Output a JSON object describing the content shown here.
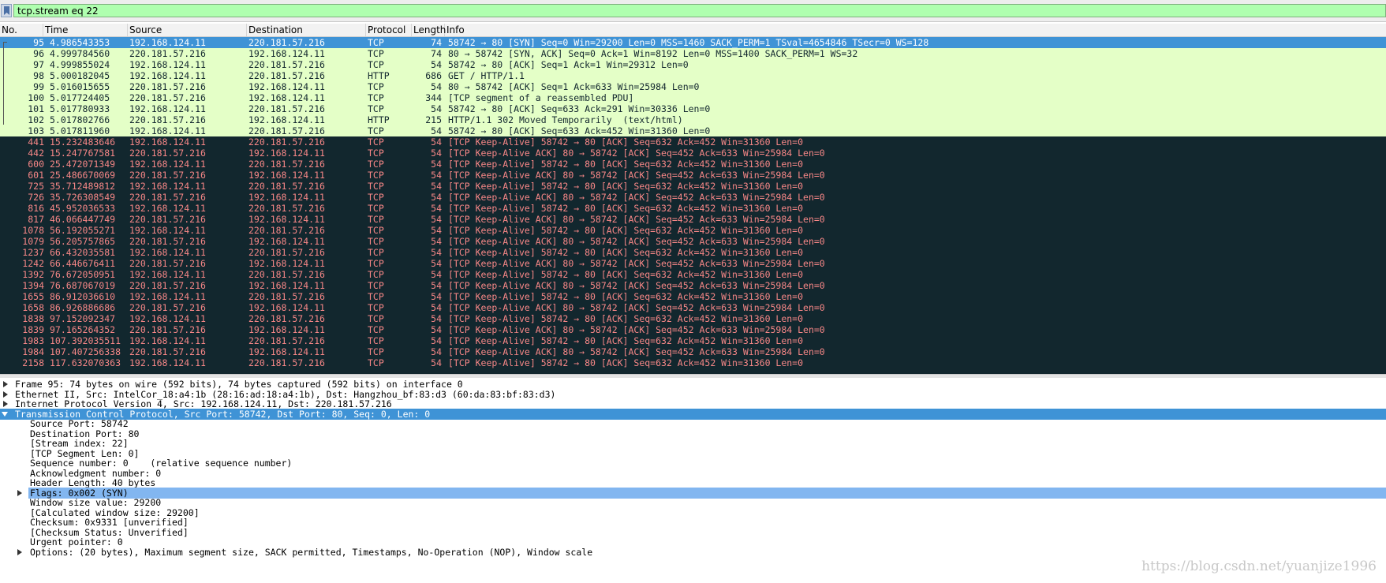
{
  "filter": {
    "value": "tcp.stream eq 22"
  },
  "columns": [
    "No.",
    "Time",
    "Source",
    "Destination",
    "Protocol",
    "Length",
    "Info"
  ],
  "packets": [
    {
      "no": "95",
      "time": "4.986543353",
      "src": "192.168.124.11",
      "dst": "220.181.57.216",
      "proto": "TCP",
      "len": "74",
      "info": "58742 → 80 [SYN] Seq=0 Win=29200 Len=0 MSS=1460 SACK_PERM=1 TSval=4654846 TSecr=0 WS=128",
      "style": "selected"
    },
    {
      "no": "96",
      "time": "4.999784560",
      "src": "220.181.57.216",
      "dst": "192.168.124.11",
      "proto": "TCP",
      "len": "74",
      "info": "80 → 58742 [SYN, ACK] Seq=0 Ack=1 Win=8192 Len=0 MSS=1400 SACK_PERM=1 WS=32",
      "style": "green"
    },
    {
      "no": "97",
      "time": "4.999855024",
      "src": "192.168.124.11",
      "dst": "220.181.57.216",
      "proto": "TCP",
      "len": "54",
      "info": "58742 → 80 [ACK] Seq=1 Ack=1 Win=29312 Len=0",
      "style": "green"
    },
    {
      "no": "98",
      "time": "5.000182045",
      "src": "192.168.124.11",
      "dst": "220.181.57.216",
      "proto": "HTTP",
      "len": "686",
      "info": "GET / HTTP/1.1",
      "style": "green"
    },
    {
      "no": "99",
      "time": "5.016015655",
      "src": "220.181.57.216",
      "dst": "192.168.124.11",
      "proto": "TCP",
      "len": "54",
      "info": "80 → 58742 [ACK] Seq=1 Ack=633 Win=25984 Len=0",
      "style": "green"
    },
    {
      "no": "100",
      "time": "5.017724405",
      "src": "220.181.57.216",
      "dst": "192.168.124.11",
      "proto": "TCP",
      "len": "344",
      "info": "[TCP segment of a reassembled PDU]",
      "style": "green"
    },
    {
      "no": "101",
      "time": "5.017780933",
      "src": "192.168.124.11",
      "dst": "220.181.57.216",
      "proto": "TCP",
      "len": "54",
      "info": "58742 → 80 [ACK] Seq=633 Ack=291 Win=30336 Len=0",
      "style": "green"
    },
    {
      "no": "102",
      "time": "5.017802766",
      "src": "220.181.57.216",
      "dst": "192.168.124.11",
      "proto": "HTTP",
      "len": "215",
      "info": "HTTP/1.1 302 Moved Temporarily  (text/html)",
      "style": "green"
    },
    {
      "no": "103",
      "time": "5.017811960",
      "src": "192.168.124.11",
      "dst": "220.181.57.216",
      "proto": "TCP",
      "len": "54",
      "info": "58742 → 80 [ACK] Seq=633 Ack=452 Win=31360 Len=0",
      "style": "green"
    },
    {
      "no": "441",
      "time": "15.232483646",
      "src": "192.168.124.11",
      "dst": "220.181.57.216",
      "proto": "TCP",
      "len": "54",
      "info": "[TCP Keep-Alive] 58742 → 80 [ACK] Seq=632 Ack=452 Win=31360 Len=0",
      "style": "dark"
    },
    {
      "no": "442",
      "time": "15.247767581",
      "src": "220.181.57.216",
      "dst": "192.168.124.11",
      "proto": "TCP",
      "len": "54",
      "info": "[TCP Keep-Alive ACK] 80 → 58742 [ACK] Seq=452 Ack=633 Win=25984 Len=0",
      "style": "dark"
    },
    {
      "no": "600",
      "time": "25.472071349",
      "src": "192.168.124.11",
      "dst": "220.181.57.216",
      "proto": "TCP",
      "len": "54",
      "info": "[TCP Keep-Alive] 58742 → 80 [ACK] Seq=632 Ack=452 Win=31360 Len=0",
      "style": "dark"
    },
    {
      "no": "601",
      "time": "25.486670069",
      "src": "220.181.57.216",
      "dst": "192.168.124.11",
      "proto": "TCP",
      "len": "54",
      "info": "[TCP Keep-Alive ACK] 80 → 58742 [ACK] Seq=452 Ack=633 Win=25984 Len=0",
      "style": "dark"
    },
    {
      "no": "725",
      "time": "35.712489812",
      "src": "192.168.124.11",
      "dst": "220.181.57.216",
      "proto": "TCP",
      "len": "54",
      "info": "[TCP Keep-Alive] 58742 → 80 [ACK] Seq=632 Ack=452 Win=31360 Len=0",
      "style": "dark"
    },
    {
      "no": "726",
      "time": "35.726308549",
      "src": "220.181.57.216",
      "dst": "192.168.124.11",
      "proto": "TCP",
      "len": "54",
      "info": "[TCP Keep-Alive ACK] 80 → 58742 [ACK] Seq=452 Ack=633 Win=25984 Len=0",
      "style": "dark"
    },
    {
      "no": "816",
      "time": "45.952036533",
      "src": "192.168.124.11",
      "dst": "220.181.57.216",
      "proto": "TCP",
      "len": "54",
      "info": "[TCP Keep-Alive] 58742 → 80 [ACK] Seq=632 Ack=452 Win=31360 Len=0",
      "style": "dark"
    },
    {
      "no": "817",
      "time": "46.066447749",
      "src": "220.181.57.216",
      "dst": "192.168.124.11",
      "proto": "TCP",
      "len": "54",
      "info": "[TCP Keep-Alive ACK] 80 → 58742 [ACK] Seq=452 Ack=633 Win=25984 Len=0",
      "style": "dark"
    },
    {
      "no": "1078",
      "time": "56.192055271",
      "src": "192.168.124.11",
      "dst": "220.181.57.216",
      "proto": "TCP",
      "len": "54",
      "info": "[TCP Keep-Alive] 58742 → 80 [ACK] Seq=632 Ack=452 Win=31360 Len=0",
      "style": "dark"
    },
    {
      "no": "1079",
      "time": "56.205757865",
      "src": "220.181.57.216",
      "dst": "192.168.124.11",
      "proto": "TCP",
      "len": "54",
      "info": "[TCP Keep-Alive ACK] 80 → 58742 [ACK] Seq=452 Ack=633 Win=25984 Len=0",
      "style": "dark"
    },
    {
      "no": "1237",
      "time": "66.432035581",
      "src": "192.168.124.11",
      "dst": "220.181.57.216",
      "proto": "TCP",
      "len": "54",
      "info": "[TCP Keep-Alive] 58742 → 80 [ACK] Seq=632 Ack=452 Win=31360 Len=0",
      "style": "dark"
    },
    {
      "no": "1242",
      "time": "66.446676411",
      "src": "220.181.57.216",
      "dst": "192.168.124.11",
      "proto": "TCP",
      "len": "54",
      "info": "[TCP Keep-Alive ACK] 80 → 58742 [ACK] Seq=452 Ack=633 Win=25984 Len=0",
      "style": "dark"
    },
    {
      "no": "1392",
      "time": "76.672050951",
      "src": "192.168.124.11",
      "dst": "220.181.57.216",
      "proto": "TCP",
      "len": "54",
      "info": "[TCP Keep-Alive] 58742 → 80 [ACK] Seq=632 Ack=452 Win=31360 Len=0",
      "style": "dark"
    },
    {
      "no": "1394",
      "time": "76.687067019",
      "src": "220.181.57.216",
      "dst": "192.168.124.11",
      "proto": "TCP",
      "len": "54",
      "info": "[TCP Keep-Alive ACK] 80 → 58742 [ACK] Seq=452 Ack=633 Win=25984 Len=0",
      "style": "dark"
    },
    {
      "no": "1655",
      "time": "86.912036610",
      "src": "192.168.124.11",
      "dst": "220.181.57.216",
      "proto": "TCP",
      "len": "54",
      "info": "[TCP Keep-Alive] 58742 → 80 [ACK] Seq=632 Ack=452 Win=31360 Len=0",
      "style": "dark"
    },
    {
      "no": "1658",
      "time": "86.926886686",
      "src": "220.181.57.216",
      "dst": "192.168.124.11",
      "proto": "TCP",
      "len": "54",
      "info": "[TCP Keep-Alive ACK] 80 → 58742 [ACK] Seq=452 Ack=633 Win=25984 Len=0",
      "style": "dark"
    },
    {
      "no": "1838",
      "time": "97.152092347",
      "src": "192.168.124.11",
      "dst": "220.181.57.216",
      "proto": "TCP",
      "len": "54",
      "info": "[TCP Keep-Alive] 58742 → 80 [ACK] Seq=632 Ack=452 Win=31360 Len=0",
      "style": "dark"
    },
    {
      "no": "1839",
      "time": "97.165264352",
      "src": "220.181.57.216",
      "dst": "192.168.124.11",
      "proto": "TCP",
      "len": "54",
      "info": "[TCP Keep-Alive ACK] 80 → 58742 [ACK] Seq=452 Ack=633 Win=25984 Len=0",
      "style": "dark"
    },
    {
      "no": "1983",
      "time": "107.392035511",
      "src": "192.168.124.11",
      "dst": "220.181.57.216",
      "proto": "TCP",
      "len": "54",
      "info": "[TCP Keep-Alive] 58742 → 80 [ACK] Seq=632 Ack=452 Win=31360 Len=0",
      "style": "dark"
    },
    {
      "no": "1984",
      "time": "107.407256338",
      "src": "220.181.57.216",
      "dst": "192.168.124.11",
      "proto": "TCP",
      "len": "54",
      "info": "[TCP Keep-Alive ACK] 80 → 58742 [ACK] Seq=452 Ack=633 Win=25984 Len=0",
      "style": "dark"
    },
    {
      "no": "2158",
      "time": "117.632070363",
      "src": "192.168.124.11",
      "dst": "220.181.57.216",
      "proto": "TCP",
      "len": "54",
      "info": "[TCP Keep-Alive] 58742 → 80 [ACK] Seq=632 Ack=452 Win=31360 Len=0",
      "style": "dark"
    }
  ],
  "details": [
    {
      "text": "Frame 95: 74 bytes on wire (592 bits), 74 bytes captured (592 bits) on interface 0",
      "indent": 0,
      "arrow": "right",
      "style": ""
    },
    {
      "text": "Ethernet II, Src: IntelCor_18:a4:1b (28:16:ad:18:a4:1b), Dst: Hangzhou_bf:83:d3 (60:da:83:bf:83:d3)",
      "indent": 0,
      "arrow": "right",
      "style": ""
    },
    {
      "text": "Internet Protocol Version 4, Src: 192.168.124.11, Dst: 220.181.57.216",
      "indent": 0,
      "arrow": "right",
      "style": ""
    },
    {
      "text": "Transmission Control Protocol, Src Port: 58742, Dst Port: 80, Seq: 0, Len: 0",
      "indent": 0,
      "arrow": "down",
      "style": "selected"
    },
    {
      "text": "Source Port: 58742",
      "indent": 1,
      "arrow": "",
      "style": ""
    },
    {
      "text": "Destination Port: 80",
      "indent": 1,
      "arrow": "",
      "style": ""
    },
    {
      "text": "[Stream index: 22]",
      "indent": 1,
      "arrow": "",
      "style": ""
    },
    {
      "text": "[TCP Segment Len: 0]",
      "indent": 1,
      "arrow": "",
      "style": ""
    },
    {
      "text": "Sequence number: 0    (relative sequence number)",
      "indent": 1,
      "arrow": "",
      "style": ""
    },
    {
      "text": "Acknowledgment number: 0",
      "indent": 1,
      "arrow": "",
      "style": ""
    },
    {
      "text": "Header Length: 40 bytes",
      "indent": 1,
      "arrow": "",
      "style": ""
    },
    {
      "text": "Flags: 0x002 (SYN)",
      "indent": 1,
      "arrow": "right",
      "style": "highlight"
    },
    {
      "text": "Window size value: 29200",
      "indent": 1,
      "arrow": "",
      "style": ""
    },
    {
      "text": "[Calculated window size: 29200]",
      "indent": 1,
      "arrow": "",
      "style": ""
    },
    {
      "text": "Checksum: 0x9331 [unverified]",
      "indent": 1,
      "arrow": "",
      "style": ""
    },
    {
      "text": "[Checksum Status: Unverified]",
      "indent": 1,
      "arrow": "",
      "style": ""
    },
    {
      "text": "Urgent pointer: 0",
      "indent": 1,
      "arrow": "",
      "style": ""
    },
    {
      "text": "Options: (20 bytes), Maximum segment size, SACK permitted, Timestamps, No-Operation (NOP), Window scale",
      "indent": 1,
      "arrow": "right",
      "style": ""
    }
  ],
  "watermark": "https://blog.csdn.net/yuanjize1996",
  "colors": {
    "green_row": "#e4ffc7",
    "dark_row": "#12272e",
    "dark_text": "#f78787",
    "selection": "#3f93d6",
    "filter_ok": "#afffaf"
  }
}
